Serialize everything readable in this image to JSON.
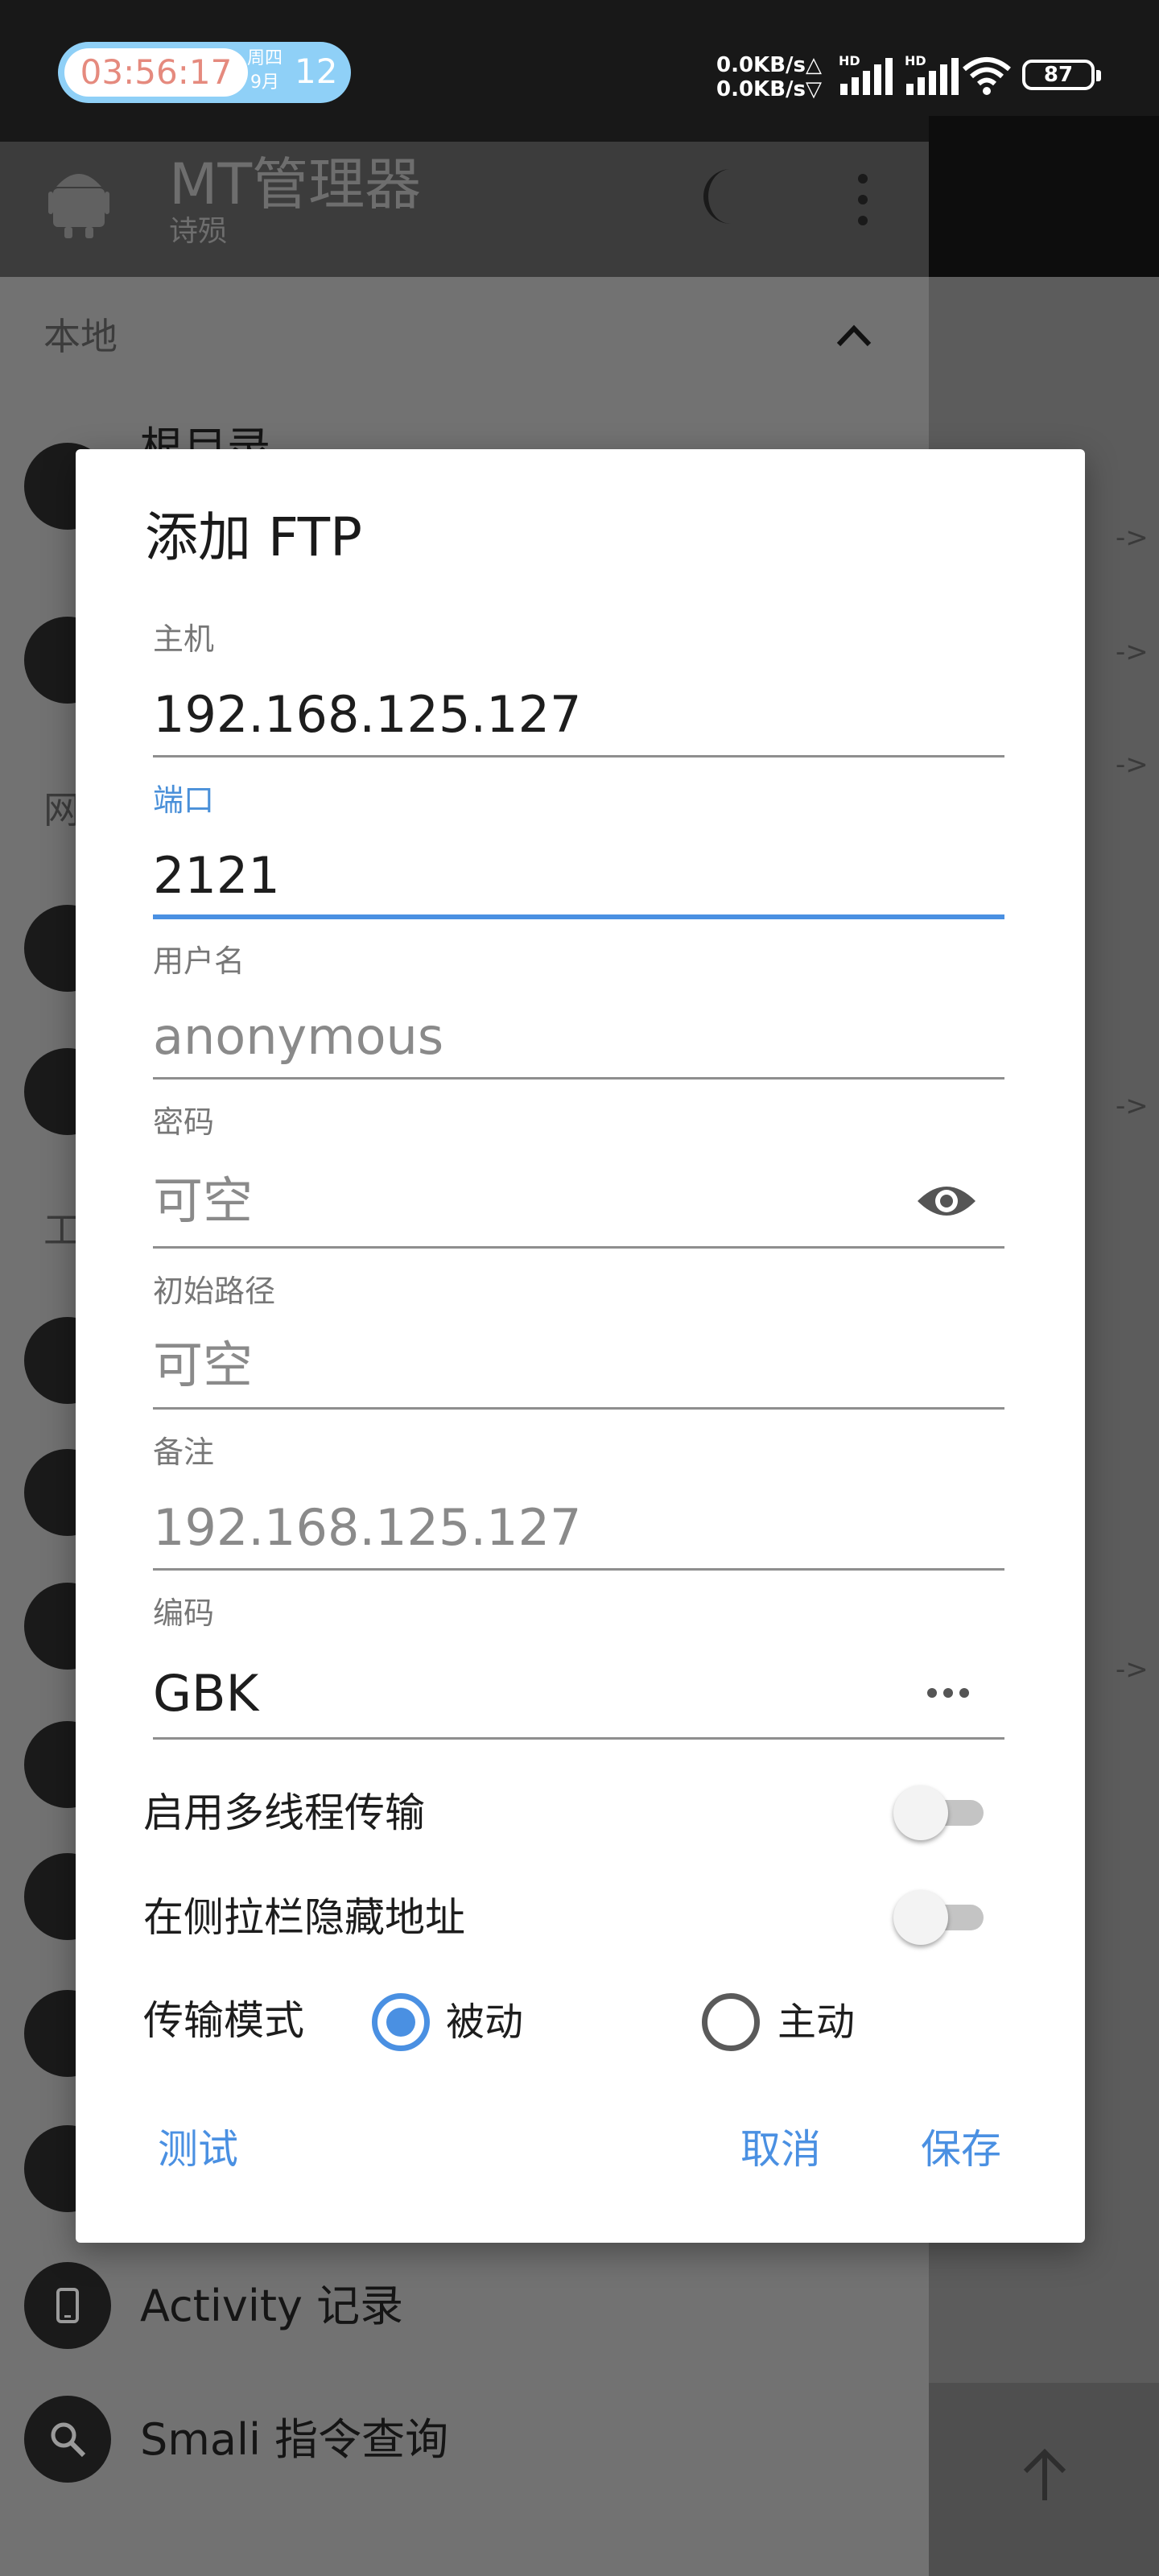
{
  "status_bar": {
    "time": "03:56:17",
    "weekday": "周四",
    "month": "9月",
    "day": "12",
    "net_up": "0.0KB/s△",
    "net_down": "0.0KB/s▽",
    "hd1": "HD",
    "hd2": "HD",
    "battery": "87"
  },
  "app_bar": {
    "title": "MT管理器",
    "subtitle": "诗殒"
  },
  "background": {
    "section_local": "本地",
    "section_net": "网",
    "section_tools": "工",
    "partial_item": "根目录",
    "items": [
      {
        "label": "Activity 记录"
      },
      {
        "label": "Smali 指令查询"
      }
    ]
  },
  "dialog": {
    "title": "添加 FTP",
    "fields": {
      "host": {
        "label": "主机",
        "value": "192.168.125.127"
      },
      "port": {
        "label": "端口",
        "value": "2121"
      },
      "username": {
        "label": "用户名",
        "placeholder": "anonymous"
      },
      "password": {
        "label": "密码",
        "placeholder": "可空"
      },
      "init_path": {
        "label": "初始路径",
        "placeholder": "可空"
      },
      "remark": {
        "label": "备注",
        "placeholder": "192.168.125.127"
      },
      "encoding": {
        "label": "编码",
        "value": "GBK"
      }
    },
    "switches": {
      "multithread": {
        "label": "启用多线程传输",
        "on": false
      },
      "hide_address": {
        "label": "在侧拉栏隐藏地址",
        "on": false
      }
    },
    "transfer_mode": {
      "label": "传输模式",
      "options": [
        "被动",
        "主动"
      ],
      "selected": "被动"
    },
    "actions": {
      "test": "测试",
      "cancel": "取消",
      "save": "保存"
    },
    "accent_color": "#4a90e2"
  }
}
